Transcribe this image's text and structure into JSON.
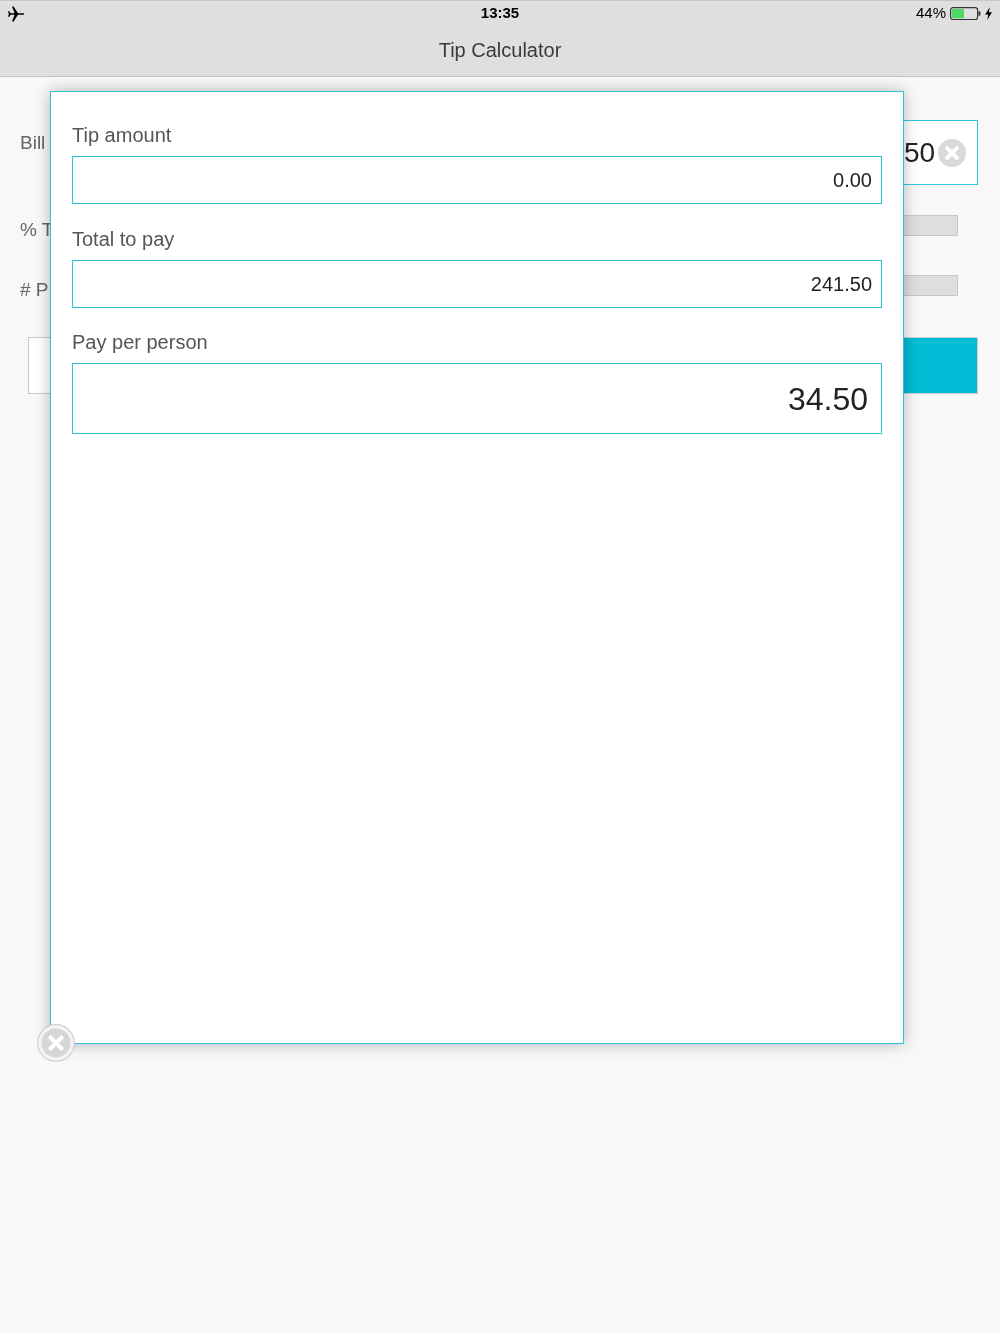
{
  "status_bar": {
    "time": "13:35",
    "battery": "44%"
  },
  "nav_bar": {
    "title": "Tip Calculator"
  },
  "background": {
    "rows": [
      {
        "kind": "field",
        "label": "Bill",
        "value": "50"
      },
      {
        "kind": "slider",
        "label": "% T"
      },
      {
        "kind": "slider",
        "label": "# P"
      }
    ],
    "buttons": [
      {
        "kind": "secondary"
      },
      {
        "kind": "primary"
      }
    ]
  },
  "dialog": {
    "fields": [
      {
        "kind": "amount",
        "label": "Tip amount",
        "value": "0.00"
      },
      {
        "kind": "amount",
        "label": "Total to pay",
        "value": "241.50"
      },
      {
        "kind": "result",
        "label": "Pay per person",
        "value": "34.50"
      }
    ]
  }
}
